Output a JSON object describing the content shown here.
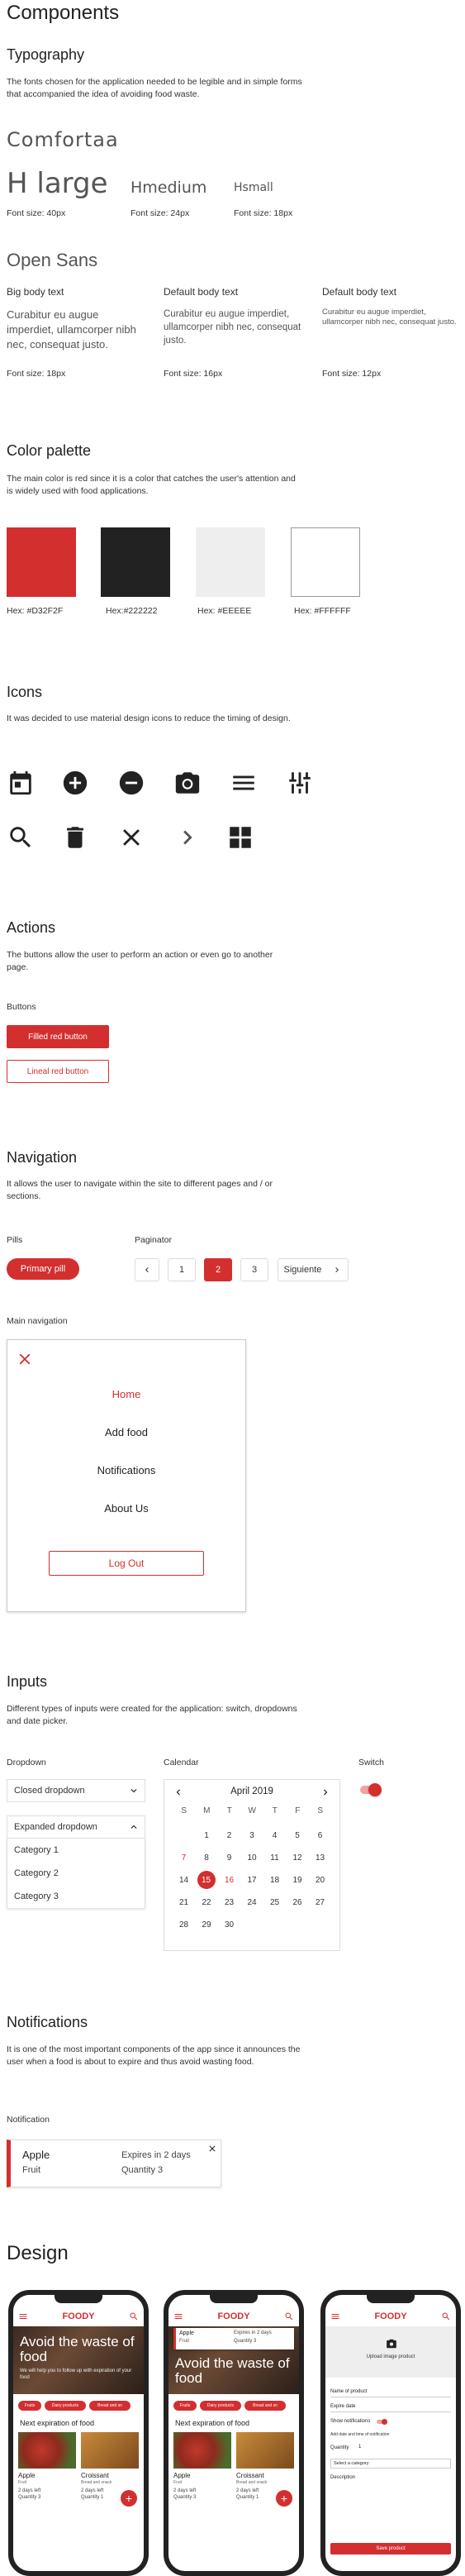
{
  "components": {
    "title": "Components",
    "typography": {
      "title": "Typography",
      "description": "The fonts chosen for the application needed to be legible and in simple forms that accompanied the idea of ​​avoiding food waste.",
      "comfortaa": {
        "name": "Comfortaa",
        "samples": [
          {
            "label": "H large",
            "size": "Font size: 40px"
          },
          {
            "label": "Hmedium",
            "size": "Font size: 24px"
          },
          {
            "label": "Hsmall",
            "size": "Font size: 18px"
          }
        ]
      },
      "opensans": {
        "name": "Open Sans",
        "samples": [
          {
            "label": "Big body text",
            "text": "Curabitur eu augue imperdiet, ullamcorper nibh nec, consequat justo.",
            "size": "Font size: 18px"
          },
          {
            "label": "Default body text",
            "text": "Curabitur eu augue imperdiet, ullamcorper nibh nec, consequat justo.",
            "size": "Font size: 16px"
          },
          {
            "label": "Default body text",
            "text": "Curabitur eu augue imperdiet, ullamcorper nibh nec, consequat justo.",
            "size": "Font size: 12px"
          }
        ]
      }
    },
    "palette": {
      "title": "Color palette",
      "description": "The main color is red since it is a color that catches the user's attention and is widely used with food applications.",
      "swatches": [
        {
          "hex": "#D32F2F",
          "label": "Hex: #D32F2F"
        },
        {
          "hex": "#222222",
          "label": "Hex:#222222"
        },
        {
          "hex": "#EEEEEE",
          "label": "Hex: #EEEEE"
        },
        {
          "hex": "#FFFFFF",
          "label": "Hex: #FFFFFF"
        }
      ]
    },
    "icons": {
      "title": "Icons",
      "description": "It was decided to use material design icons to reduce  the timing of design.",
      "names": [
        "calendar-icon",
        "add-circle-icon",
        "remove-circle-icon",
        "camera-icon",
        "menu-icon",
        "tune-icon",
        "search-icon",
        "delete-icon",
        "close-icon",
        "chevron-right-icon",
        "dashboard-icon"
      ]
    },
    "actions": {
      "title": "Actions",
      "description": "The buttons allow the user to perform an action or even go to another page.",
      "buttons_label": "Buttons",
      "filled": "Filled red button",
      "lineal": "Lineal red button"
    },
    "navigation": {
      "title": "Navigation",
      "description": "It allows the user to navigate within the site to different pages and / or sections.",
      "pills_label": "Pills",
      "pill": "Primary pill",
      "paginator_label": "Paginator",
      "pages": [
        "1",
        "2",
        "3"
      ],
      "next": "Siguiente",
      "main_nav_label": "Main navigation",
      "menu": [
        "Home",
        "Add food",
        "Notifications",
        "About Us"
      ],
      "logout": "Log Out"
    },
    "inputs": {
      "title": "Inputs",
      "description": "Different types of inputs were created for the application: switch, dropdowns and date picker.",
      "dropdown_label": "Dropdown",
      "closed": "Closed dropdown",
      "expanded": "Expanded dropdown",
      "options": [
        "Category 1",
        "Category 2",
        "Category 3"
      ],
      "calendar_label": "Calendar",
      "month": "April 2019",
      "weekdays": [
        "S",
        "M",
        "T",
        "W",
        "T",
        "F",
        "S"
      ],
      "weeks": [
        [
          "",
          "1",
          "2",
          "3",
          "4",
          "5",
          "6"
        ],
        [
          "7",
          "8",
          "9",
          "10",
          "11",
          "12",
          "13"
        ],
        [
          "14",
          "15",
          "16",
          "17",
          "18",
          "19",
          "20"
        ],
        [
          "21",
          "22",
          "23",
          "24",
          "25",
          "26",
          "27"
        ],
        [
          "28",
          "29",
          "30",
          "",
          "",
          "",
          ""
        ]
      ],
      "switch_label": "Switch"
    },
    "notifications": {
      "title": "Notifications",
      "description": "It is one of the most important components of the app since it announces the user when a food is about to expire and thus avoid wasting food.",
      "label": "Notification",
      "item": {
        "name": "Apple",
        "type": "Fruit",
        "expires": "Expires in 2 days",
        "quantity": "Quantity 3"
      }
    }
  },
  "design": {
    "title": "Design",
    "brand": "FOODY",
    "hero": "Avoid the waste of food",
    "hero_sub": "We will help you to follow up with expiration of your food",
    "chips": [
      "Fruits",
      "Dairy products",
      "Bread and sn"
    ],
    "section": "Next expiration of food",
    "cards": [
      {
        "name": "Apple",
        "type": "Fruit",
        "days": "2 days left",
        "qty": "Quantity 3"
      },
      {
        "name": "Croissant",
        "type": "Bread and snack",
        "days": "2 days left",
        "qty": "Quantity 1"
      }
    ],
    "toast": {
      "name": "Apple",
      "type": "Fruit",
      "expires": "Expires in 2 days",
      "qty": "Quantity 3"
    },
    "form": {
      "upload": "Upload image product",
      "fields": [
        "Name of product",
        "Expire date",
        "Show notifications",
        "Add date and time of notification",
        "Quantity"
      ],
      "qty": "1",
      "category": "Select a category",
      "description": "Description",
      "save": "Save product"
    }
  }
}
